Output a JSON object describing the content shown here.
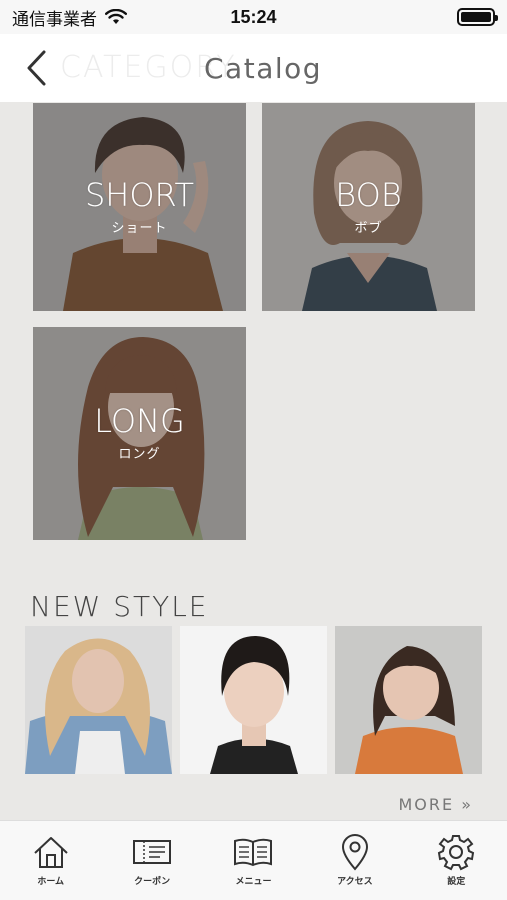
{
  "status_bar": {
    "carrier": "通信事業者",
    "time": "15:24"
  },
  "header": {
    "ghost_title": "CATEGORY",
    "title": "Catalog"
  },
  "catalog": [
    {
      "label": "SHORT",
      "sub": "ショート"
    },
    {
      "label": "BOB",
      "sub": "ボブ"
    },
    {
      "label": "LONG",
      "sub": "ロング"
    }
  ],
  "new_style": {
    "title": "NEW STYLE",
    "more": "MORE"
  },
  "tabs": [
    {
      "label": "ホーム",
      "icon": "home-icon"
    },
    {
      "label": "クーポン",
      "icon": "coupon-icon"
    },
    {
      "label": "メニュー",
      "icon": "menu-book-icon"
    },
    {
      "label": "アクセス",
      "icon": "location-pin-icon"
    },
    {
      "label": "設定",
      "icon": "gear-icon"
    }
  ]
}
